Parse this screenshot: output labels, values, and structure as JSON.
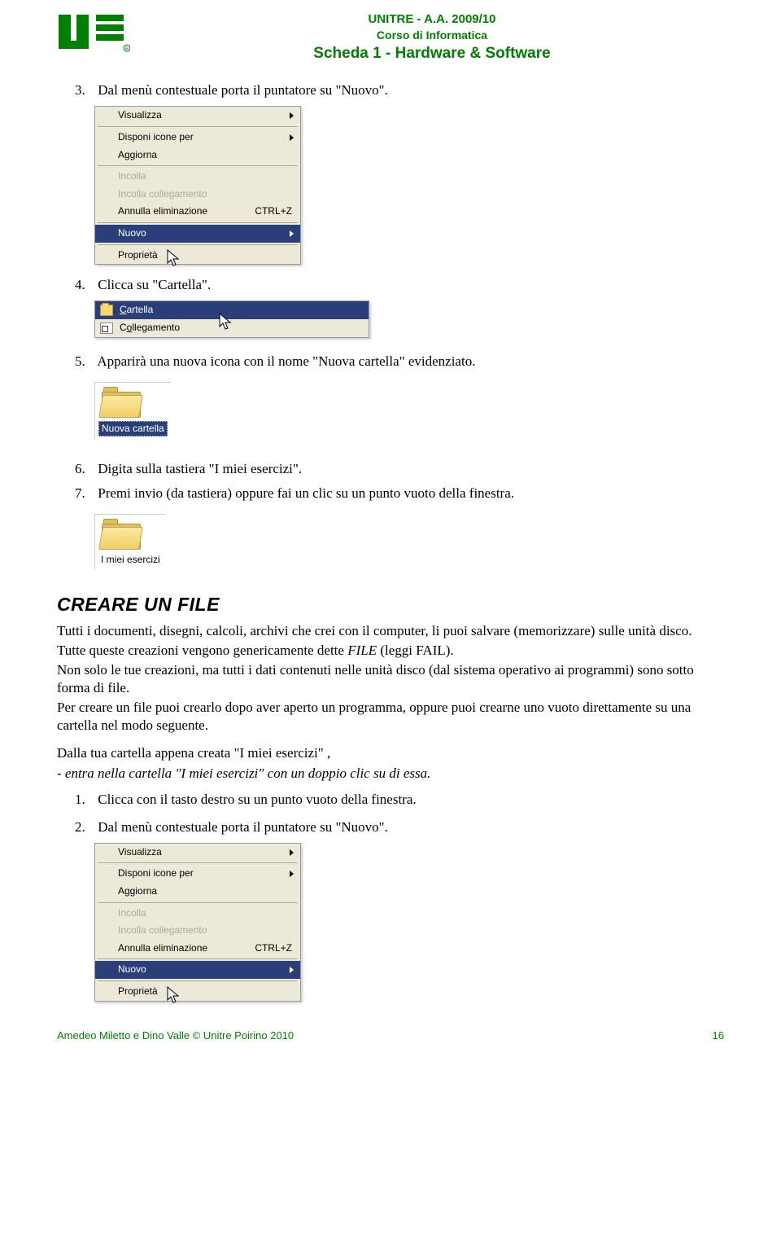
{
  "header": {
    "line1": "UNITRE - A.A. 2009/10",
    "line2": "Corso di Informatica",
    "line3": "Scheda 1 - Hardware & Software"
  },
  "steps": {
    "s3_num": "3.",
    "s3": "Dal menù contestuale porta il puntatore su \"Nuovo\".",
    "s4_num": "4.",
    "s4": "Clicca su \"Cartella\".",
    "s5_num": "5.",
    "s5": "Apparirà una nuova icona con il nome \"Nuova cartella\" evidenziato.",
    "s6_num": "6.",
    "s6": "Digita sulla tastiera \"I miei esercizi\".",
    "s7_num": "7.",
    "s7": "Premi invio (da tastiera) oppure fai un clic su un punto vuoto della finestra."
  },
  "ctxmenu": {
    "visualizza": "Visualizza",
    "disponi": "Disponi icone per",
    "aggiorna": "Aggiorna",
    "incolla": "Incolla",
    "incolla_coll": "Incolla collegamento",
    "annulla": "Annulla eliminazione",
    "annulla_key": "CTRL+Z",
    "nuovo": "Nuovo",
    "proprieta": "Proprietà"
  },
  "submenu": {
    "cartella_pre": "C",
    "cartella_rest": "artella",
    "colleg_pre": "C",
    "colleg_mid": "o",
    "colleg_rest": "llegamento"
  },
  "iconlabels": {
    "nuova_cartella": "Nuova cartella",
    "imiei": "I miei esercizi"
  },
  "section_title": "CREARE UN FILE",
  "para": {
    "p1": "Tutti i documenti, disegni, calcoli, archivi che crei con il computer, li puoi salvare (memorizzare) sulle unità disco.",
    "p2a": "Tutte queste creazioni vengono genericamente dette ",
    "p2b": "FILE",
    "p2c": " (leggi FAIL).",
    "p3": "Non solo le tue creazioni, ma tutti i dati contenuti nelle unità disco (dal sistema operativo ai programmi) sono sotto forma di file.",
    "p4": "Per creare un file puoi crearlo dopo aver aperto un programma, oppure puoi crearne uno vuoto direttamente su una cartella nel modo seguente.",
    "p5": "Dalla tua cartella appena creata \"I miei esercizi\" ,",
    "p6": "- entra nella cartella \"I miei esercizi\" con un doppio clic su di essa.",
    "list1_num": "1.",
    "list1": "Clicca con il tasto destro su un punto vuoto della finestra.",
    "list2_num": "2.",
    "list2": "Dal menù contestuale porta il puntatore su \"Nuovo\"."
  },
  "footer": {
    "left": "Amedeo Miletto e Dino Valle © Unitre Poirino 2010",
    "right": "16"
  }
}
